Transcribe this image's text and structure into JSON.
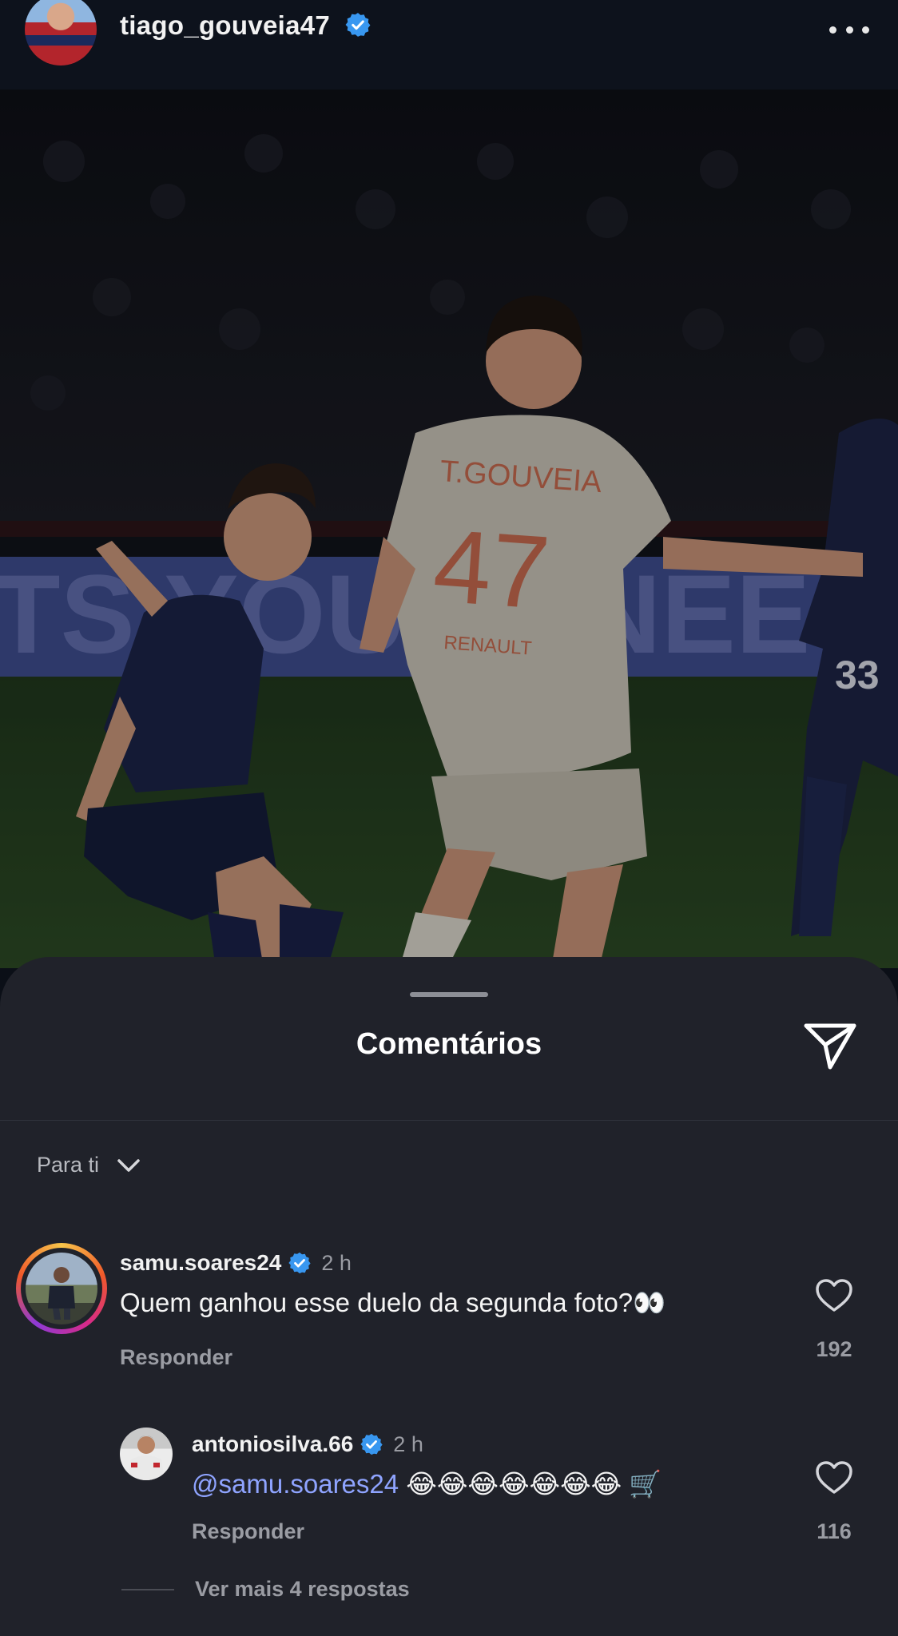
{
  "post": {
    "username": "tiago_gouveia47",
    "jersey_name": "T.GOUVEIA",
    "jersey_number": "47",
    "other_number": "33",
    "sponsor": "RENAULT",
    "banner": "TS YOUTE   NEE"
  },
  "sheet": {
    "title": "Comentários",
    "filter_label": "Para ti"
  },
  "comments": [
    {
      "username": "samu.soares24",
      "time": "2 h",
      "text": "Quem ganhou esse duelo da segunda foto?👀",
      "reply_label": "Responder",
      "likes": "192"
    },
    {
      "username": "antoniosilva.66",
      "time": "2 h",
      "mention": "@samu.soares24",
      "text": "😂😂😂😂😂😂😂 🛒",
      "reply_label": "Responder",
      "likes": "116"
    }
  ],
  "more_replies_label": "Ver mais 4 respostas",
  "colors": {
    "sheet_bg": "#20222a",
    "verified_blue": "#3897f0",
    "mention_blue": "#8fa4ff"
  }
}
